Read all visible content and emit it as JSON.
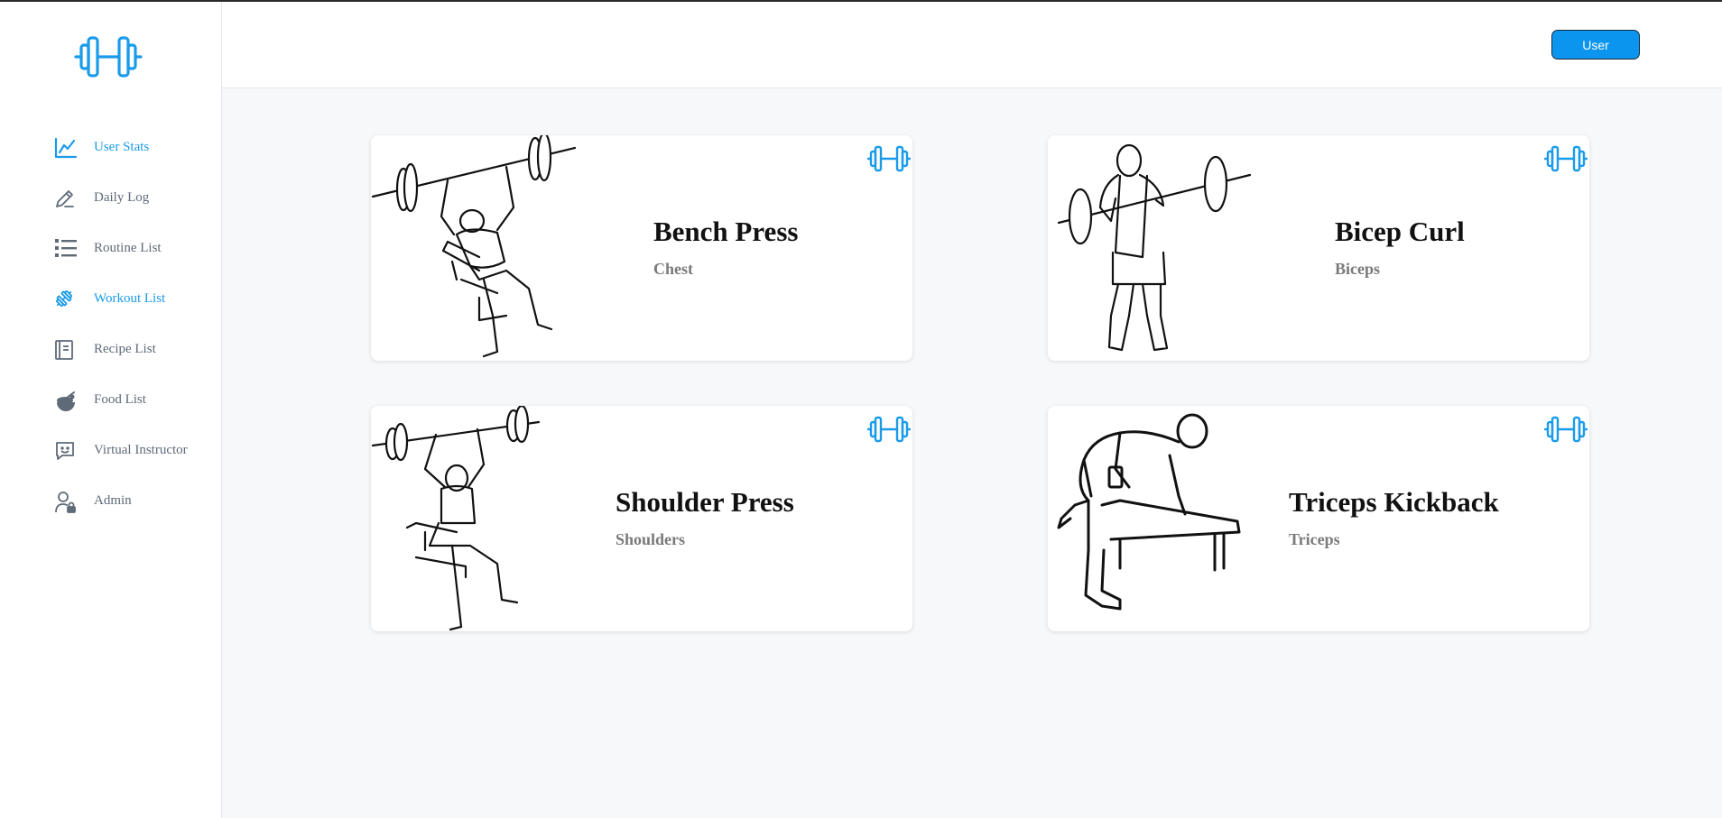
{
  "app": {
    "logo_icon": "dumbbell-icon",
    "accent_color": "#1a9be9"
  },
  "sidebar": {
    "items": [
      {
        "label": "User Stats",
        "icon": "line-chart-icon",
        "active": true
      },
      {
        "label": "Daily Log",
        "icon": "pencil-icon",
        "active": false
      },
      {
        "label": "Routine List",
        "icon": "list-icon",
        "active": false
      },
      {
        "label": "Workout List",
        "icon": "dumbbell-icon",
        "active": true
      },
      {
        "label": "Recipe List",
        "icon": "recipe-book-icon",
        "active": false
      },
      {
        "label": "Food List",
        "icon": "food-bowl-icon",
        "active": false
      },
      {
        "label": "Virtual Instructor",
        "icon": "chat-bot-icon",
        "active": false
      },
      {
        "label": "Admin",
        "icon": "admin-user-icon",
        "active": false
      }
    ]
  },
  "header": {
    "user_button_label": "User"
  },
  "workouts": [
    {
      "title": "Bench Press",
      "muscle": "Chest",
      "image": "bench-press-illustration"
    },
    {
      "title": "Bicep Curl",
      "muscle": "Biceps",
      "image": "bicep-curl-illustration"
    },
    {
      "title": "Shoulder Press",
      "muscle": "Shoulders",
      "image": "shoulder-press-illustration"
    },
    {
      "title": "Triceps Kickback",
      "muscle": "Triceps",
      "image": "triceps-kickback-illustration"
    }
  ]
}
